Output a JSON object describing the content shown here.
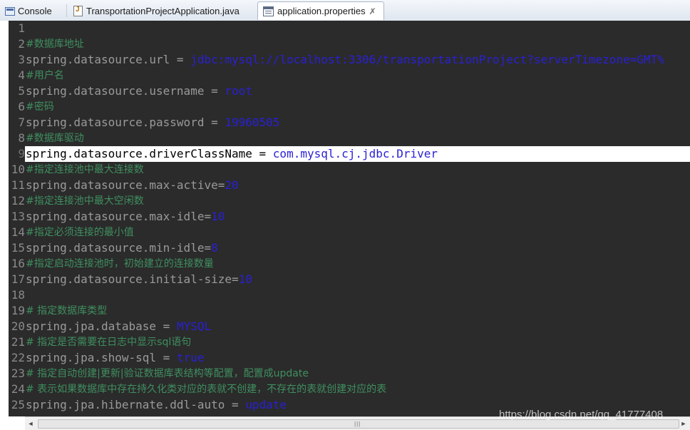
{
  "tabs": [
    {
      "label": "Console",
      "icon": "console-icon"
    },
    {
      "label": "TransportationProjectApplication.java",
      "icon": "java-file-icon"
    },
    {
      "label": "application.properties",
      "icon": "properties-file-icon",
      "active": true,
      "close": "✗"
    }
  ],
  "editor": {
    "lines": [
      {
        "n": "1"
      },
      {
        "n": "2",
        "comment": "#数据库地址"
      },
      {
        "n": "3",
        "key": "spring.datasource.url",
        "eq": " = ",
        "value": "jdbc:mysql://localhost:3306/transportationProject?serverTimezone=GMT%"
      },
      {
        "n": "4",
        "comment": "#用户名"
      },
      {
        "n": "5",
        "key": "spring.datasource.username",
        "eq": " = ",
        "value": "root"
      },
      {
        "n": "6",
        "comment": "#密码"
      },
      {
        "n": "7",
        "key": "spring.datasource.password",
        "eq": " = ",
        "value": "19960505"
      },
      {
        "n": "8",
        "comment": "#数据库驱动"
      },
      {
        "n": "9",
        "key": "spring.datasource.driverClassName",
        "eq": " = ",
        "value": "com.mysql.cj.jdbc.Driver",
        "highlight": true
      },
      {
        "n": "10",
        "comment": "#指定连接池中最大连接数"
      },
      {
        "n": "11",
        "key": "spring.datasource.max-active",
        "eq": "=",
        "value": "20"
      },
      {
        "n": "12",
        "comment": "#指定连接池中最大空闲数"
      },
      {
        "n": "13",
        "key": "spring.datasource.max-idle",
        "eq": "=",
        "value": "10"
      },
      {
        "n": "14",
        "comment": "#指定必须连接的最小值"
      },
      {
        "n": "15",
        "key": "spring.datasource.min-idle",
        "eq": "=",
        "value": "8"
      },
      {
        "n": "16",
        "comment": "#指定启动连接池时，初始建立的连接数量"
      },
      {
        "n": "17",
        "key": "spring.datasource.initial-size",
        "eq": "=",
        "value": "10"
      },
      {
        "n": "18"
      },
      {
        "n": "19",
        "comment": "# 指定数据库类型"
      },
      {
        "n": "20",
        "key": "spring.jpa.database",
        "eq": " = ",
        "value": "MYSQL"
      },
      {
        "n": "21",
        "comment": "# 指定是否需要在日志中显示sql语句"
      },
      {
        "n": "22",
        "key": "spring.jpa.show-sql",
        "eq": " = ",
        "value": "true"
      },
      {
        "n": "23",
        "comment": "# 指定自动创建|更新|验证数据库表结构等配置，配置成update"
      },
      {
        "n": "24",
        "comment": "# 表示如果数据库中存在持久化类对应的表就不创建，不存在的表就创建对应的表"
      },
      {
        "n": "25",
        "key": "spring.jpa.hibernate.ddl-auto",
        "eq": " = ",
        "value": "update"
      }
    ]
  },
  "scrollbar": {
    "left_arrow": "◄",
    "right_arrow": "►",
    "grip": "|||"
  },
  "watermark": "https://blog.csdn.net/qq_41777408",
  "colors": {
    "editor_background": "#2b2b2b",
    "comment": "#3f8f5f",
    "key": "#9a9a9a",
    "value": "#2a1fd6",
    "highlight_line": "#ffffff"
  }
}
